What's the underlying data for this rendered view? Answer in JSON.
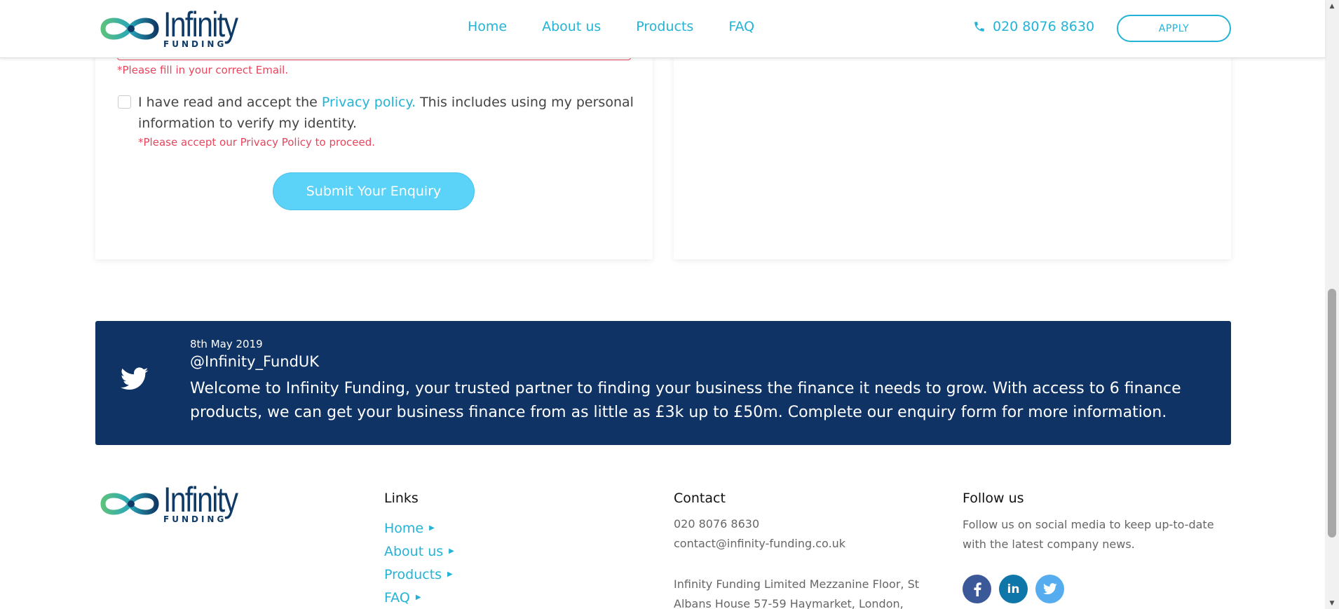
{
  "header": {
    "logo": {
      "word": "Infinity",
      "sub": "FUNDING"
    },
    "nav": [
      "Home",
      "About us",
      "Products",
      "FAQ"
    ],
    "phone": "020 8076 8630",
    "apply": "APPLY"
  },
  "form": {
    "email_error": "*Please fill in your correct Email.",
    "consent_prefix": "I have read and accept the ",
    "consent_link": "Privacy policy.",
    "consent_suffix": " This includes using my personal information to verify my identity.",
    "privacy_error": "*Please accept our Privacy Policy to proceed.",
    "submit": "Submit Your Enquiry"
  },
  "tweet": {
    "date": "8th May 2019",
    "handle": "@Infinity_FundUK",
    "text": "Welcome to Infinity Funding, your trusted partner to finding your business the finance it needs to grow. With access to 6 finance products, we can get your business finance from as little as £3k up to £50m. Complete our enquiry form for more information."
  },
  "footer": {
    "logo": {
      "word": "Infinity",
      "sub": "FUNDING"
    },
    "links_title": "Links",
    "links": [
      "Home",
      "About us",
      "Products",
      "FAQ"
    ],
    "contact_title": "Contact",
    "contact_phone": "020 8076 8630",
    "contact_email": "contact@infinity-funding.co.uk",
    "contact_address": "Infinity Funding Limited Mezzanine Floor, St Albans House 57-59 Haymarket, London,",
    "follow_title": "Follow us",
    "follow_text": "Follow us on social media to keep up-to-date with the latest company news.",
    "social": [
      {
        "name": "facebook",
        "color": "#3b5998"
      },
      {
        "name": "linkedin",
        "color": "#0e76a8"
      },
      {
        "name": "twitter",
        "color": "#55acee"
      }
    ]
  }
}
